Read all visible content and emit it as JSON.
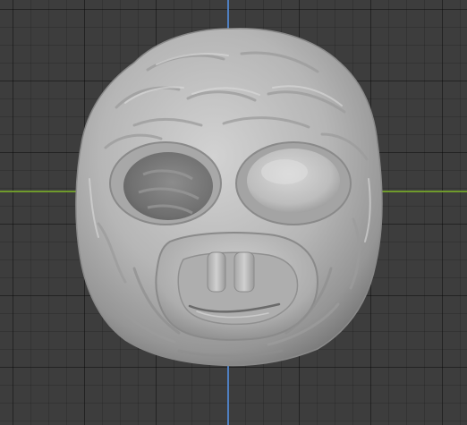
{
  "viewport": {
    "background": "#3d3d3d",
    "grid_color": "#2f2f2f",
    "axis_x_color": "#6f9a2c",
    "axis_y_color": "#4f7fc0"
  },
  "object": {
    "kind": "sculpted-creature-head-mesh",
    "material_color": "#b9b9b9",
    "icon": "mesh-icon"
  }
}
